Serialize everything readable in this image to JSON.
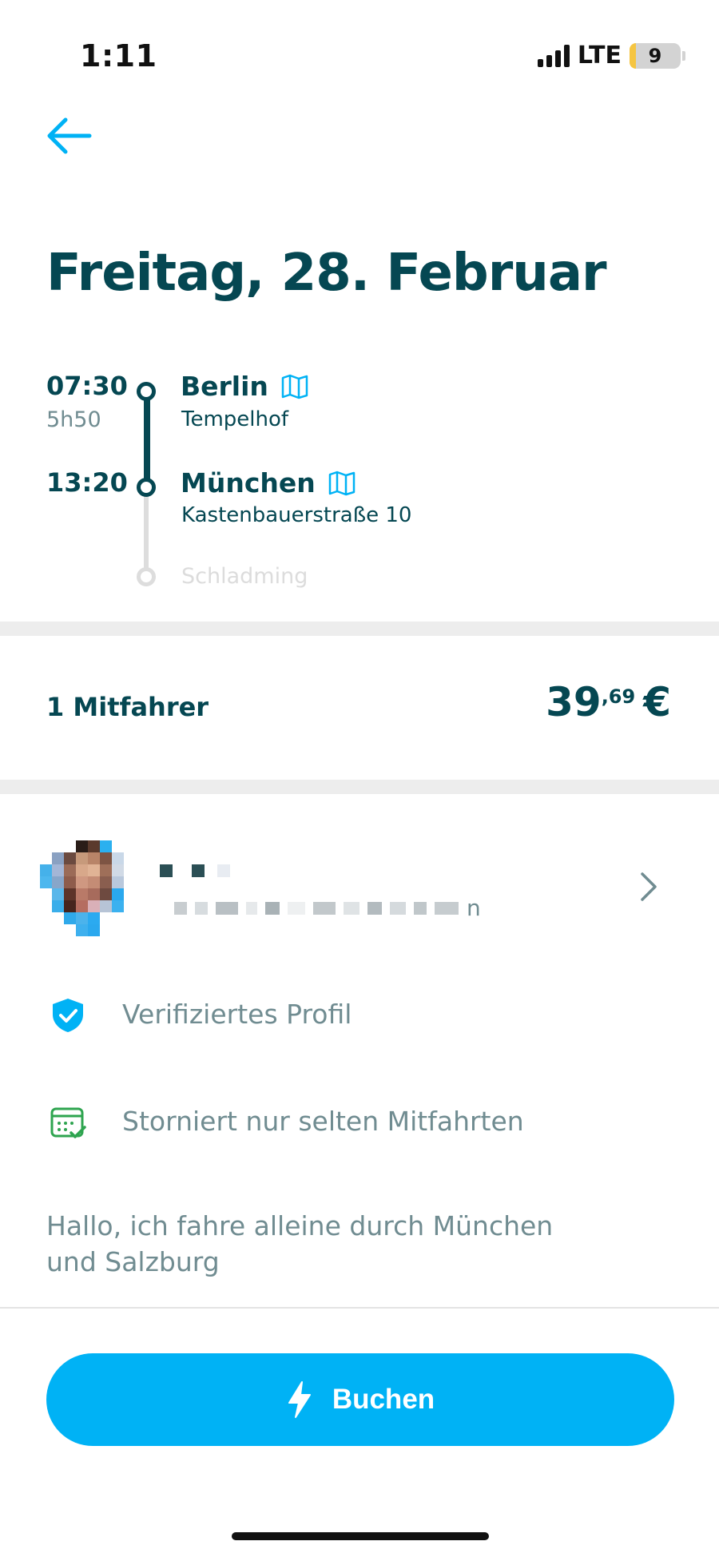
{
  "status_bar": {
    "time": "1:11",
    "network": "LTE",
    "battery": "9",
    "battery_color": "#f5c542"
  },
  "header": {
    "back_icon": "arrow-left-icon",
    "accent": "#00b2f5"
  },
  "trip": {
    "date_title": "Freitag, 28. Februar",
    "departure": {
      "time": "07:30",
      "city": "Berlin",
      "address": "Tempelhof",
      "map_icon": "map-icon"
    },
    "duration": "5h50",
    "arrival": {
      "time": "13:20",
      "city": "München",
      "address": "Kastenbauerstraße 10",
      "map_icon": "map-icon"
    },
    "final_stop": "Schladming"
  },
  "booking": {
    "passengers": "1 Mitfahrer",
    "price_whole": "39",
    "price_decimal": ",69",
    "currency": "€"
  },
  "driver": {
    "features": [
      {
        "icon": "verified-shield-icon",
        "label": "Verifiziertes Profil",
        "color": "#00b2f5"
      },
      {
        "icon": "calendar-check-icon",
        "label": "Storniert nur selten Mitfahrten",
        "color": "#2ea44f"
      }
    ],
    "bio": "Hallo, ich fahre alleine durch München und Salzburg",
    "name_suffix": "n"
  },
  "cta": {
    "label": "Buchen",
    "icon": "lightning-icon",
    "color": "#00b2f5"
  }
}
